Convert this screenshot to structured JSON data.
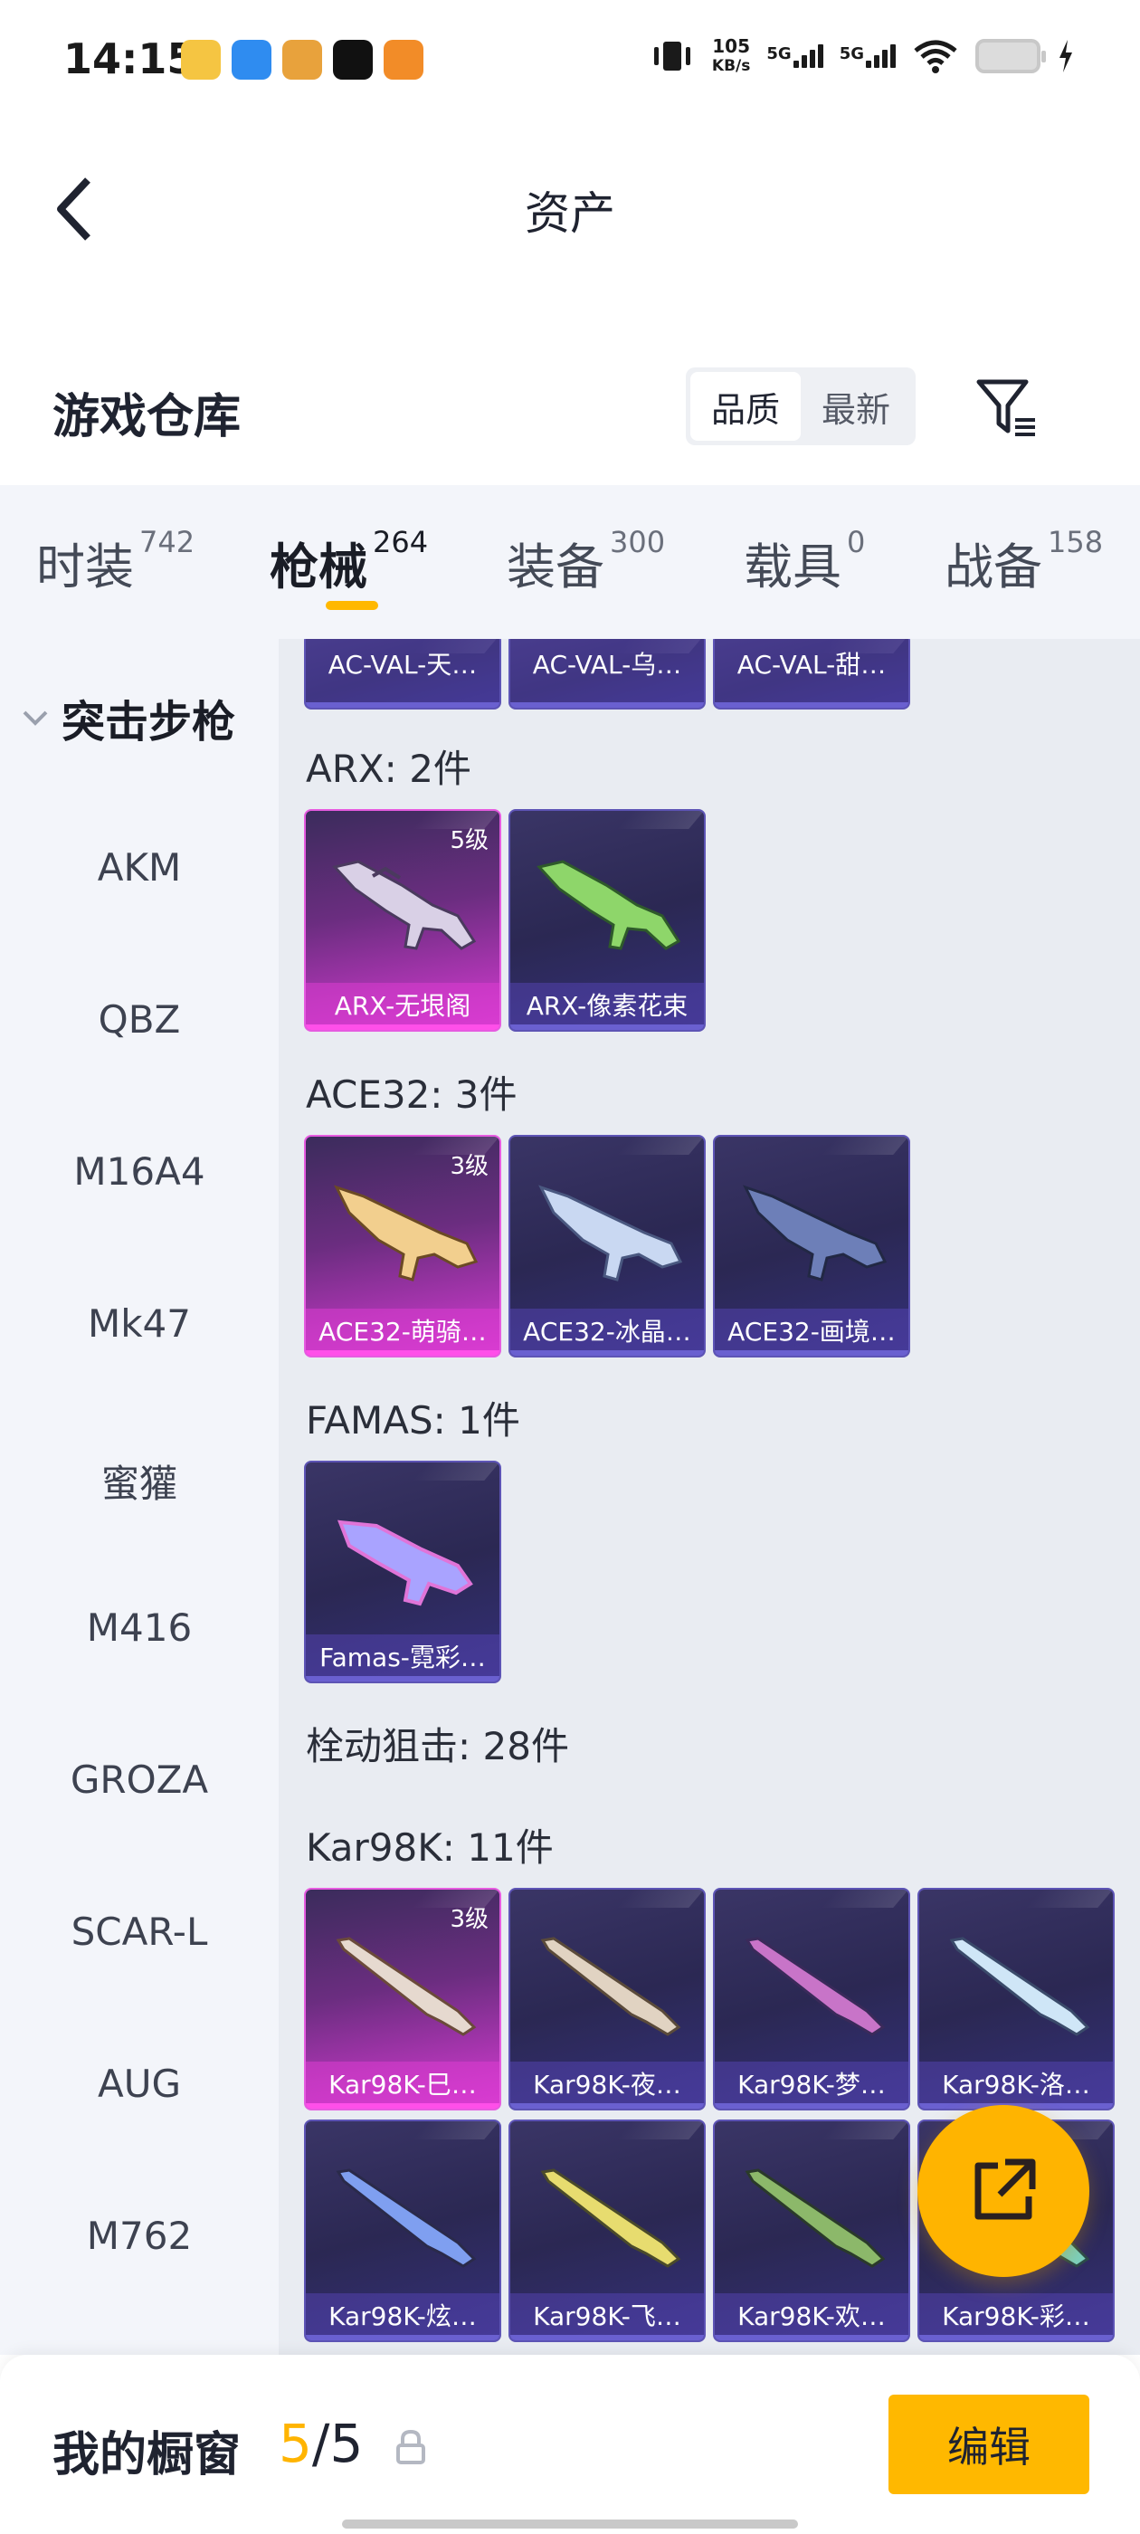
{
  "status_bar": {
    "time": "14:15",
    "net_speed": "105",
    "net_unit": "KB/s",
    "sig1": "5G",
    "sig2": "5G"
  },
  "header": {
    "title": "资产"
  },
  "warehouse": {
    "title": "游戏仓库",
    "sort_options": [
      "品质",
      "最新"
    ],
    "sort_active": "品质"
  },
  "tabs": [
    {
      "label": "时装",
      "count": "742"
    },
    {
      "label": "枪械",
      "count": "264"
    },
    {
      "label": "装备",
      "count": "300"
    },
    {
      "label": "载具",
      "count": "0"
    },
    {
      "label": "战备",
      "count": "158"
    }
  ],
  "active_tab": "枪械",
  "sidebar": {
    "group": "突击步枪",
    "items": [
      "AKM",
      "QBZ",
      "M16A4",
      "Mk47",
      "蜜獾",
      "M416",
      "GROZA",
      "SCAR-L",
      "AUG",
      "M762"
    ]
  },
  "content": {
    "top_partial": [
      "AC-VAL-天…",
      "AC-VAL-乌…",
      "AC-VAL-甜…"
    ],
    "groups": [
      {
        "label": "ARX: 2件",
        "items": [
          {
            "name": "ARX-无垠阁",
            "level": "5级",
            "legend": true,
            "color": "#d9d0e6"
          },
          {
            "name": "ARX-像素花束",
            "level": "",
            "legend": false,
            "color": "#8ed66a"
          }
        ]
      },
      {
        "label": "ACE32: 3件",
        "items": [
          {
            "name": "ACE32-萌骑…",
            "level": "3级",
            "legend": true,
            "color": "#f2cf8e"
          },
          {
            "name": "ACE32-冰晶…",
            "level": "",
            "legend": false,
            "color": "#c9d8f2"
          },
          {
            "name": "ACE32-画境…",
            "level": "",
            "legend": false,
            "color": "#6d7fb8"
          }
        ]
      },
      {
        "label": "FAMAS: 1件",
        "items": [
          {
            "name": "Famas-霓彩…",
            "level": "",
            "legend": false,
            "color": "#a9a3ff"
          }
        ]
      }
    ],
    "sniper_label": "栓动狙击: 28件",
    "kar_label": "Kar98K: 11件",
    "kar_items": [
      {
        "name": "Kar98K-巳…",
        "level": "3级",
        "legend": true,
        "color": "#e6d9cf"
      },
      {
        "name": "Kar98K-夜…",
        "level": "",
        "legend": false,
        "color": "#e1d3c2"
      },
      {
        "name": "Kar98K-梦…",
        "level": "",
        "legend": false,
        "color": "#c874c8"
      },
      {
        "name": "Kar98K-洛…",
        "level": "",
        "legend": false,
        "color": "#cfe6f7"
      },
      {
        "name": "Kar98K-炫…",
        "level": "",
        "legend": false,
        "color": "#7f9ff0"
      },
      {
        "name": "Kar98K-飞…",
        "level": "",
        "legend": false,
        "color": "#e7dc6f"
      },
      {
        "name": "Kar98K-欢…",
        "level": "",
        "legend": false,
        "color": "#8cb86a"
      },
      {
        "name": "Kar98K-彩…",
        "level": "",
        "legend": false,
        "color": "#7ad1c0"
      }
    ]
  },
  "bottom_bar": {
    "label": "我的橱窗",
    "current": "5",
    "total": "/5",
    "edit_label": "编辑"
  },
  "colors": {
    "accent": "#ffb800",
    "legend_card": "#e65be0",
    "epic_card": "#5d54b5"
  }
}
